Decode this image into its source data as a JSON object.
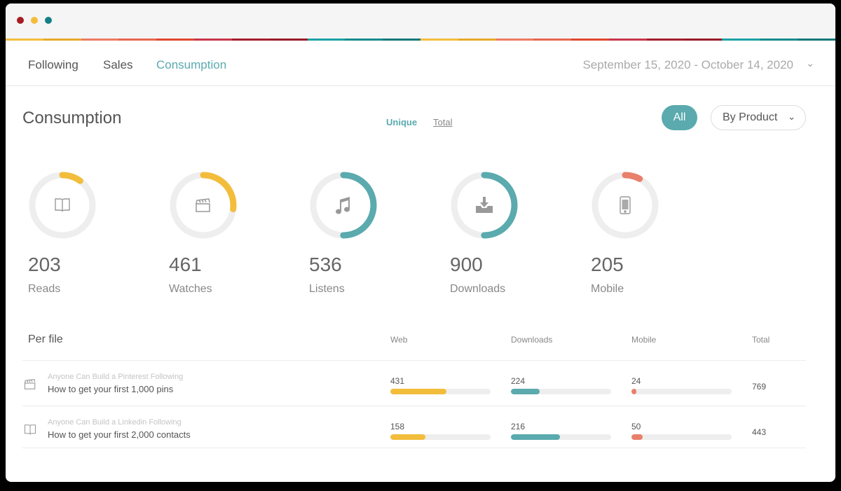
{
  "colors": {
    "teal": "#5aaaae",
    "yellow": "#f3bd3c",
    "coral": "#e8806b",
    "track": "#eeeeee"
  },
  "nav": {
    "tabs": [
      "Following",
      "Sales",
      "Consumption"
    ],
    "active": 2,
    "date_range": "September 15, 2020 - October 14, 2020"
  },
  "header": {
    "title": "Consumption",
    "unique": "Unique",
    "total": "Total",
    "all": "All",
    "by_product": "By Product"
  },
  "stats": [
    {
      "value": "203",
      "label": "Reads",
      "icon": "book-icon",
      "fraction": 0.1,
      "color": "#f3bd3c"
    },
    {
      "value": "461",
      "label": "Watches",
      "icon": "clapperboard-icon",
      "fraction": 0.27,
      "color": "#f3bd3c"
    },
    {
      "value": "536",
      "label": "Listens",
      "icon": "music-note-icon",
      "fraction": 0.5,
      "color": "#5aaaae"
    },
    {
      "value": "900",
      "label": "Downloads",
      "icon": "download-icon",
      "fraction": 0.5,
      "color": "#5aaaae"
    },
    {
      "value": "205",
      "label": "Mobile",
      "icon": "mobile-icon",
      "fraction": 0.08,
      "color": "#e8806b"
    }
  ],
  "per_file": {
    "title": "Per file",
    "columns": [
      "Web",
      "Downloads",
      "Mobile",
      "Total"
    ],
    "rows": [
      {
        "icon": "clapperboard-icon",
        "course": "Anyone Can Build a Pinterest Following",
        "title": "How to get your first 1,000 pins",
        "web": "431",
        "web_frac": 0.56,
        "downloads": "224",
        "downloads_frac": 0.29,
        "mobile": "24",
        "mobile_frac": 0.05,
        "total": "769"
      },
      {
        "icon": "book-icon",
        "course": "Anyone Can Build a Linkedin Following",
        "title": "How to get your first 2,000 contacts",
        "web": "158",
        "web_frac": 0.35,
        "downloads": "216",
        "downloads_frac": 0.49,
        "mobile": "50",
        "mobile_frac": 0.11,
        "total": "443"
      }
    ]
  }
}
